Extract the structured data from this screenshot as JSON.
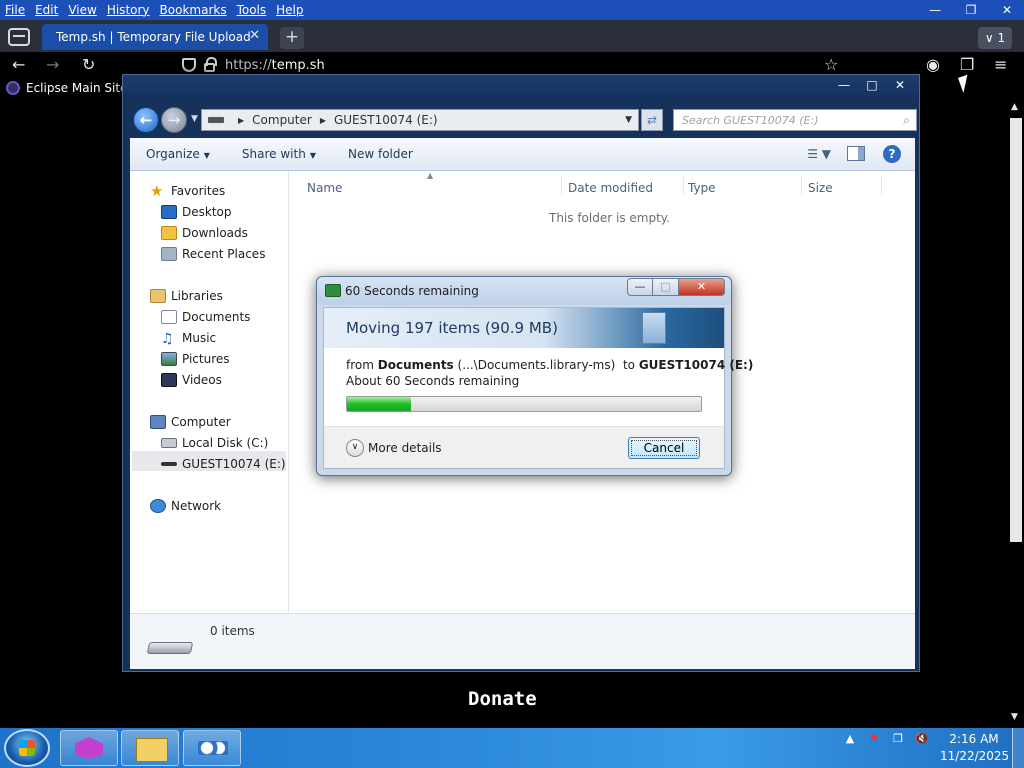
{
  "firefox": {
    "menu": [
      "File",
      "Edit",
      "View",
      "History",
      "Bookmarks",
      "Tools",
      "Help"
    ],
    "tab_title": "Temp.sh | Temporary File Upload",
    "tab_count": "1",
    "url_scheme": "https://",
    "url_host": "temp.sh",
    "bookmark": "Eclipse Main Site"
  },
  "page": {
    "donate": "Donate"
  },
  "explorer": {
    "breadcrumb": [
      "Computer",
      "GUEST10074 (E:)"
    ],
    "search_placeholder": "Search GUEST10074 (E:)",
    "toolbar": {
      "organize": "Organize",
      "share_with": "Share with",
      "new_folder": "New folder"
    },
    "nav": {
      "favorites": "Favorites",
      "desktop": "Desktop",
      "downloads": "Downloads",
      "recent_places": "Recent Places",
      "libraries": "Libraries",
      "documents": "Documents",
      "music": "Music",
      "pictures": "Pictures",
      "videos": "Videos",
      "computer": "Computer",
      "local_disk": "Local Disk (C:)",
      "guest_drive": "GUEST10074 (E:)",
      "network": "Network"
    },
    "columns": [
      "Name",
      "Date modified",
      "Type",
      "Size"
    ],
    "empty_message": "This folder is empty.",
    "details_items": "0 items"
  },
  "dialog": {
    "title": "60 Seconds remaining",
    "heading": "Moving 197 items (90.9 MB)",
    "from_prefix": "from",
    "from_name": "Documents",
    "from_path": "(...\\Documents.library-ms)",
    "to_prefix": "to",
    "to_name": "GUEST10074 (E:)",
    "remaining": "About 60 Seconds remaining",
    "progress_fraction": 0.18,
    "more_details": "More details",
    "cancel": "Cancel"
  },
  "taskbar": {
    "time": "2:16 AM",
    "date": "11/22/2025"
  }
}
